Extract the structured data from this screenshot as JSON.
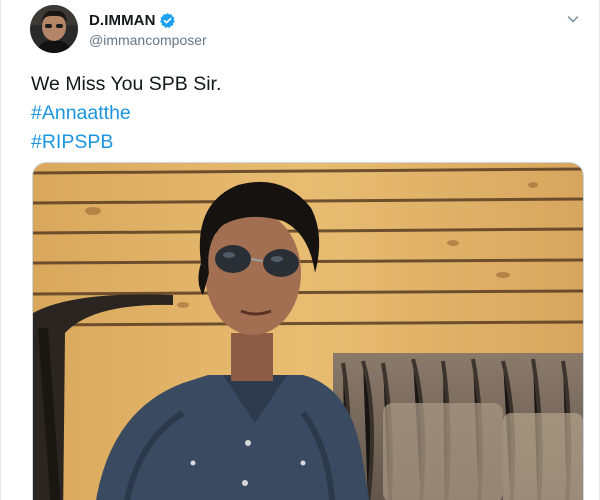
{
  "tweet": {
    "display_name": "D.IMMAN",
    "handle": "@immancomposer",
    "verified": true,
    "text_lines": [
      "We Miss You SPB Sir."
    ],
    "hashtags": [
      "#Annaatthe",
      "#RIPSPB"
    ]
  },
  "icons": {
    "verified": "verified-badge-icon",
    "menu": "chevron-down-icon"
  },
  "colors": {
    "link": "#1b95e0",
    "verified": "#1da1f2",
    "text": "#14171a",
    "secondary": "#657786"
  }
}
